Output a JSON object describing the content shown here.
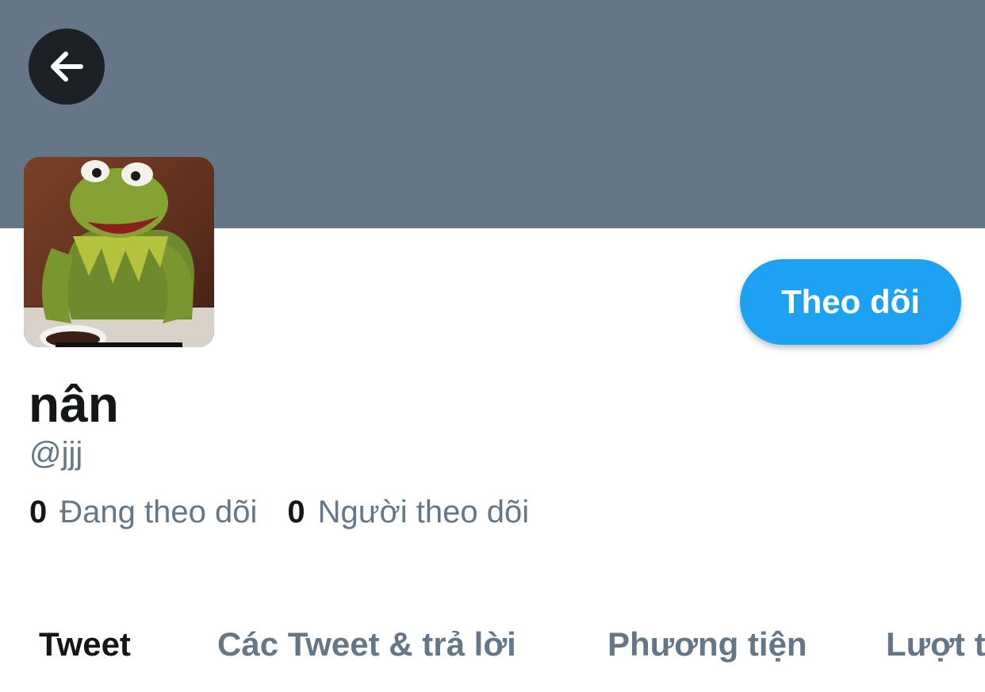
{
  "colors": {
    "banner": "#657786",
    "accent": "#1da1f2",
    "text_primary": "#14171a",
    "text_secondary": "#657786"
  },
  "header": {
    "back_icon": "arrow-left-icon"
  },
  "profile": {
    "avatar": "kermit-avatar",
    "display_name": "nân",
    "handle": "@jjj",
    "follow_label": "Theo dõi",
    "stats": {
      "following_count": "0",
      "following_label": "Đang theo dõi",
      "followers_count": "0",
      "followers_label": "Người theo dõi"
    }
  },
  "tabs": [
    {
      "label": "Tweet",
      "active": true
    },
    {
      "label": "Các Tweet & trả lời",
      "active": false
    },
    {
      "label": "Phương tiện",
      "active": false
    },
    {
      "label": "Lượt thích",
      "active": false
    }
  ]
}
